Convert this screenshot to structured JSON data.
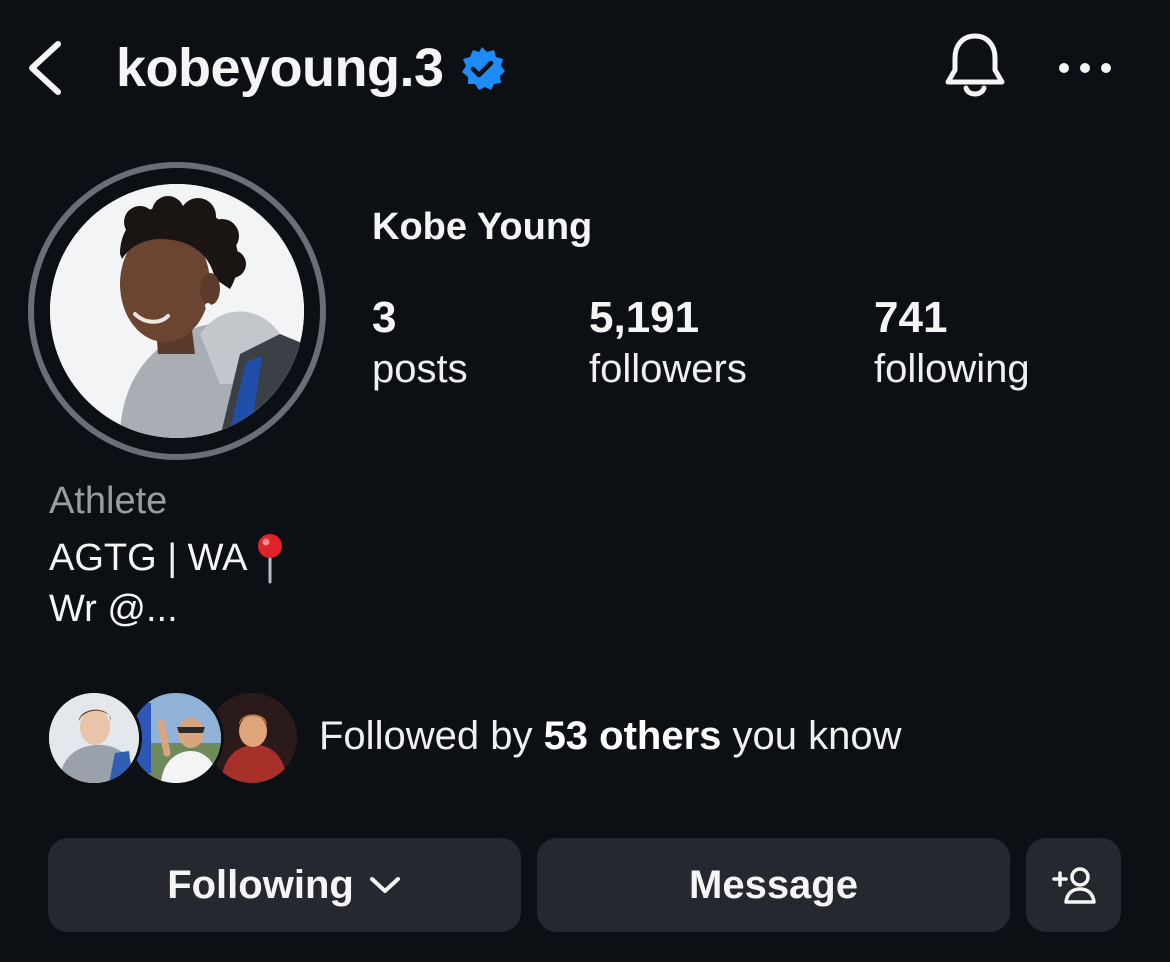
{
  "header": {
    "username": "kobeyoung.3",
    "verified": true,
    "icons": [
      "back-arrow-icon",
      "verified-badge-icon",
      "bell-icon",
      "more-icon"
    ]
  },
  "profile": {
    "full_name": "Kobe Young",
    "stats": [
      {
        "value": "3",
        "label": "posts"
      },
      {
        "value": "5,191",
        "label": "followers"
      },
      {
        "value": "741",
        "label": "following"
      }
    ],
    "category": "Athlete",
    "bio_line1": "AGTG | WA",
    "bio_line2": "Wr @..."
  },
  "mutuals": {
    "prefix": "Followed by ",
    "count_text": "53 others",
    "suffix": " you know"
  },
  "buttons": {
    "following_label": "Following",
    "message_label": "Message"
  },
  "colors": {
    "background": "#0c0f14",
    "button": "#25282e",
    "verified": "#1d8cf8",
    "secondary_text": "#9a9ca1"
  }
}
